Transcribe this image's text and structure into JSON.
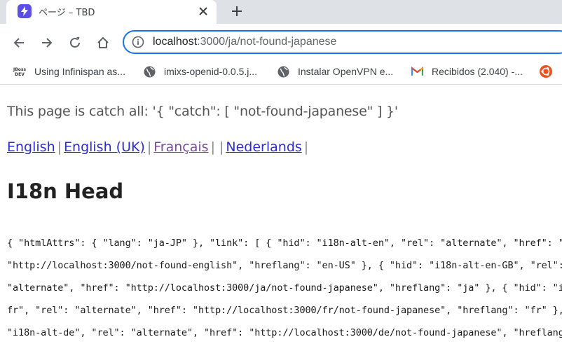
{
  "browser": {
    "tab": {
      "title": "ページ – TBD",
      "favicon": "lightning-bolt-icon",
      "favicon_color": "#5b4fe8"
    },
    "address_bar": {
      "url_host": "localhost",
      "url_path": ":3000/ja/not-found-japanese"
    },
    "bookmarks": [
      {
        "label": "Using Infinispan as...",
        "icon": "jboss-dev-icon"
      },
      {
        "label": "imixs-openid-0.0.5.j...",
        "icon": "globe-icon"
      },
      {
        "label": "Instalar OpenVPN e...",
        "icon": "globe-icon"
      },
      {
        "label": "Recibidos (2.040) -...",
        "icon": "gmail-icon"
      },
      {
        "label": "",
        "icon": "ubuntu-icon"
      }
    ]
  },
  "page": {
    "catch_text": "This page is catch all: '{ \"catch\": [ \"not-found-japanese\" ] }'",
    "languages": [
      {
        "label": "English",
        "visited": false
      },
      {
        "label": "English (UK)",
        "visited": false
      },
      {
        "label": "Français",
        "visited": true
      },
      {
        "label": "",
        "visited": false
      },
      {
        "label": "Nederlands",
        "visited": false
      }
    ],
    "separator": "|",
    "heading": "I18n Head",
    "json_lines": [
      "{ \"htmlAttrs\": { \"lang\": \"ja-JP\" }, \"link\": [ { \"hid\": \"i18n-alt-en\", \"rel\": \"alternate\", \"href\": \"",
      "\"http://localhost:3000/not-found-english\", \"hreflang\": \"en-US\" }, { \"hid\": \"i18n-alt-en-GB\", \"rel\":",
      "\"alternate\", \"href\": \"http://localhost:3000/ja/not-found-japanese\", \"hreflang\": \"ja\" }, { \"hid\": \"i",
      "fr\", \"rel\": \"alternate\", \"href\": \"http://localhost:3000/fr/not-found-japanese\", \"hreflang\": \"fr\" },",
      "\"i18n-alt-de\", \"rel\": \"alternate\", \"href\": \"http://localhost:3000/de/not-found-japanese\", \"hreflang"
    ]
  },
  "colors": {
    "accent": "#1a73e8",
    "link": "#2c2cd0",
    "visited_link": "#7a4a9e"
  }
}
